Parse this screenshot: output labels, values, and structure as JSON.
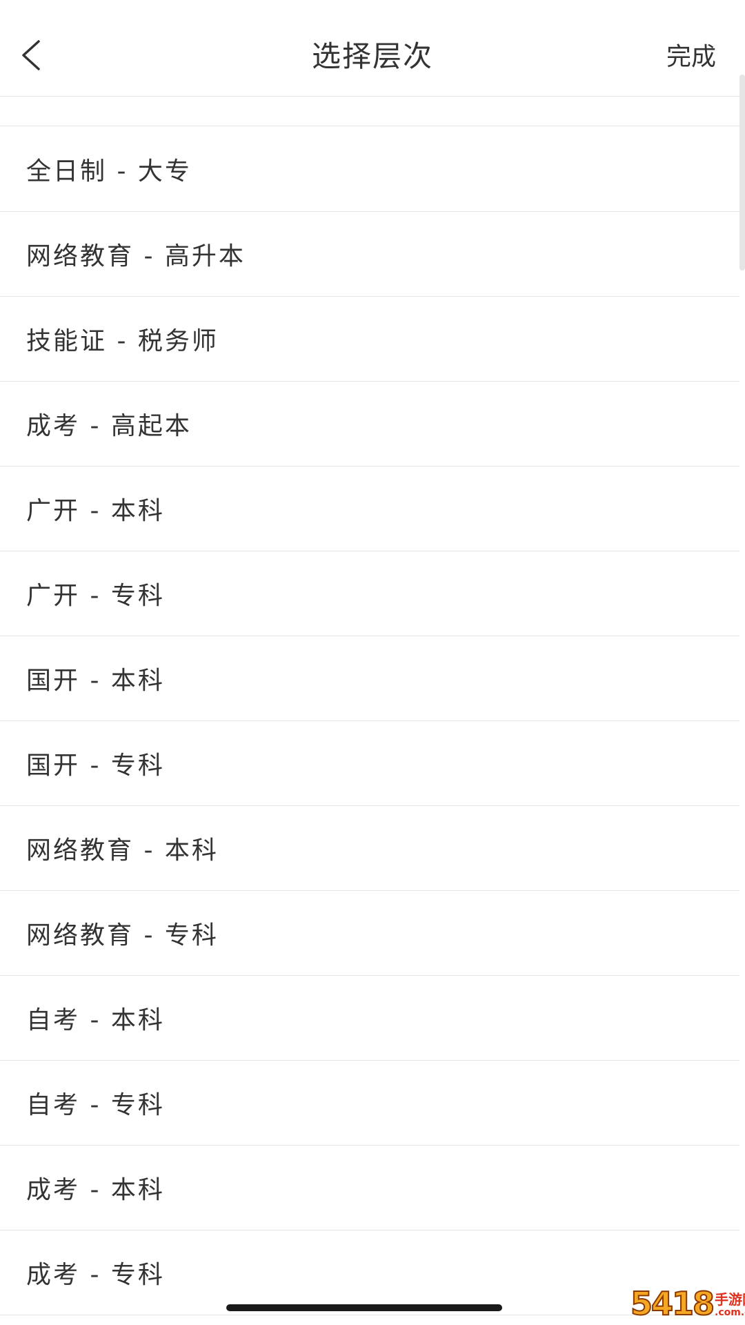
{
  "header": {
    "title": "选择层次",
    "done_label": "完成",
    "back_icon": "chevron-left-icon"
  },
  "levels": [
    "全日制 - 大专",
    "网络教育 - 高升本",
    "技能证 - 税务师",
    "成考 - 高起本",
    "广开 - 本科",
    "广开 - 专科",
    "国开 - 本科",
    "国开 - 专科",
    "网络教育 - 本科",
    "网络教育 - 专科",
    "自考 - 本科",
    "自考 - 专科",
    "成考 - 本科",
    "成考 - 专科"
  ],
  "watermark": {
    "main": "5418",
    "cn": "手游网",
    "domain": ".com.cn"
  },
  "colors": {
    "text": "#333333",
    "divider": "#e6e6e6",
    "background": "#ffffff"
  }
}
